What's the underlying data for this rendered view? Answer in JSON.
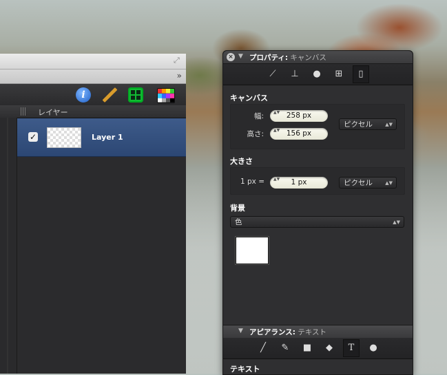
{
  "main_window": {
    "overflow_label": "»",
    "resize_label": "⤢",
    "toolbar": {
      "info_label": "i",
      "icons": [
        "info-icon",
        "ruler-icon",
        "grid-icon",
        "color-palette-icon"
      ]
    },
    "layers": {
      "header": "レイヤー",
      "items": [
        {
          "name": "Layer 1",
          "visible": true,
          "check": "✓"
        }
      ]
    }
  },
  "properties_panel": {
    "close_label": "×",
    "disclose_label": "▼",
    "title_bold": "プロパティ:",
    "title_sub": "キャンバス",
    "tabs": [
      "ruler-icon",
      "transform-icon",
      "shape-icon",
      "grid-icon",
      "document-icon"
    ],
    "tab_glyphs": [
      "⟋",
      "⊥",
      "●",
      "⊞",
      "▯"
    ],
    "canvas": {
      "title": "キャンバス",
      "width_label": "幅:",
      "width_value": "258 px",
      "height_label": "高さ:",
      "height_value": "156 px",
      "unit": "ピクセル"
    },
    "size": {
      "title": "大きさ",
      "scale_label": "1 px =",
      "scale_value": "1 px",
      "unit": "ピクセル"
    },
    "background": {
      "title": "背景",
      "type": "色",
      "color": "#ffffff"
    },
    "stepper_arrows": "▲▼",
    "popup_caret": "▲▼"
  },
  "appearance_panel": {
    "disclose_label": "▼",
    "title_bold": "アピアランス:",
    "title_sub": "テキスト",
    "tabs": [
      "line-icon",
      "brush-icon",
      "fill-icon",
      "eraser-icon",
      "text-icon",
      "shadow-icon"
    ],
    "tab_glyphs": [
      "╱",
      "✎",
      "■",
      "◆",
      "T",
      "●"
    ],
    "section_title": "テキスト"
  }
}
